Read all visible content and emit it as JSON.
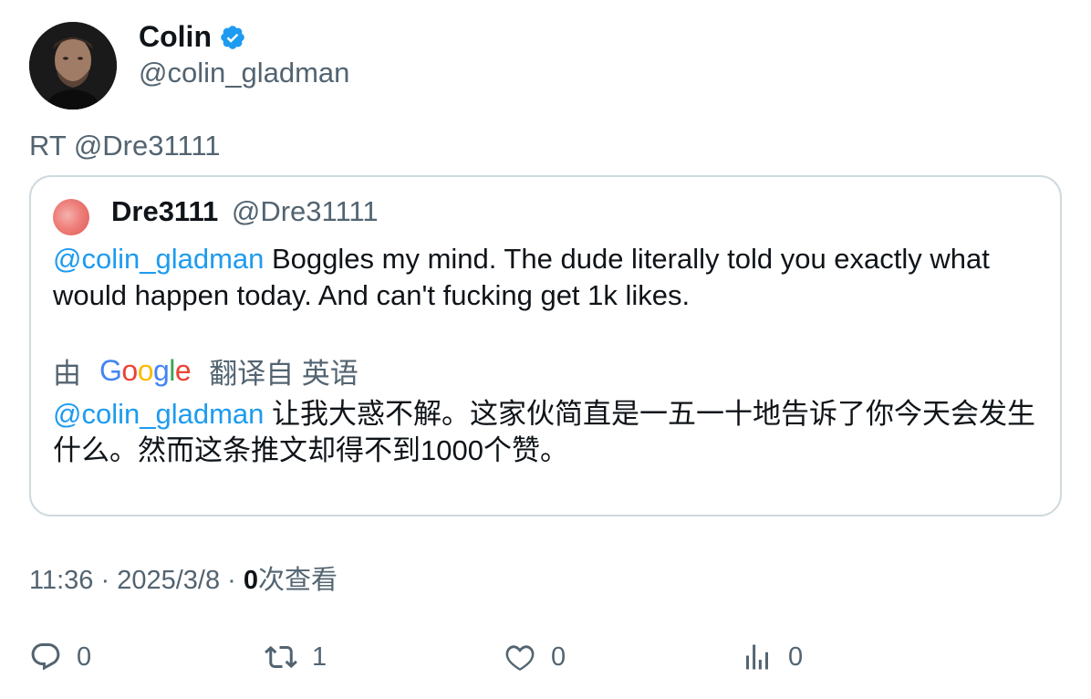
{
  "author": {
    "name": "Colin",
    "handle": "@colin_gladman",
    "verified": true,
    "verified_color": "#1d9bf0"
  },
  "retweet_line": "RT @Dre31111",
  "quoted": {
    "name": "Dre3111",
    "handle": "@Dre31111",
    "mention": "@colin_gladman",
    "text": " Boggles my mind. The dude literally told you exactly what would happen today. And can't fucking get 1k likes.",
    "translation": {
      "prefix": "由",
      "provider": "Google",
      "suffix": "翻译自 英语",
      "mention": "@colin_gladman",
      "text": " 让我大惑不解。这家伙简直是一五一十地告诉了你今天会发生什么。然而这条推文却得不到1000个赞。"
    }
  },
  "meta": {
    "time": "11:36",
    "sep1": " · ",
    "date": "2025/3/8",
    "sep2": " · ",
    "views": "0",
    "views_label": "次查看"
  },
  "actions": {
    "replies": {
      "icon": "reply-icon",
      "count": "0"
    },
    "retweets": {
      "icon": "retweet-icon",
      "count": "1"
    },
    "likes": {
      "icon": "heart-icon",
      "count": "0"
    },
    "views": {
      "icon": "analytics-icon",
      "count": "0"
    }
  },
  "colors": {
    "text": "#0f1419",
    "secondary": "#536471",
    "link": "#1d9bf0",
    "border": "#cfd9de"
  }
}
